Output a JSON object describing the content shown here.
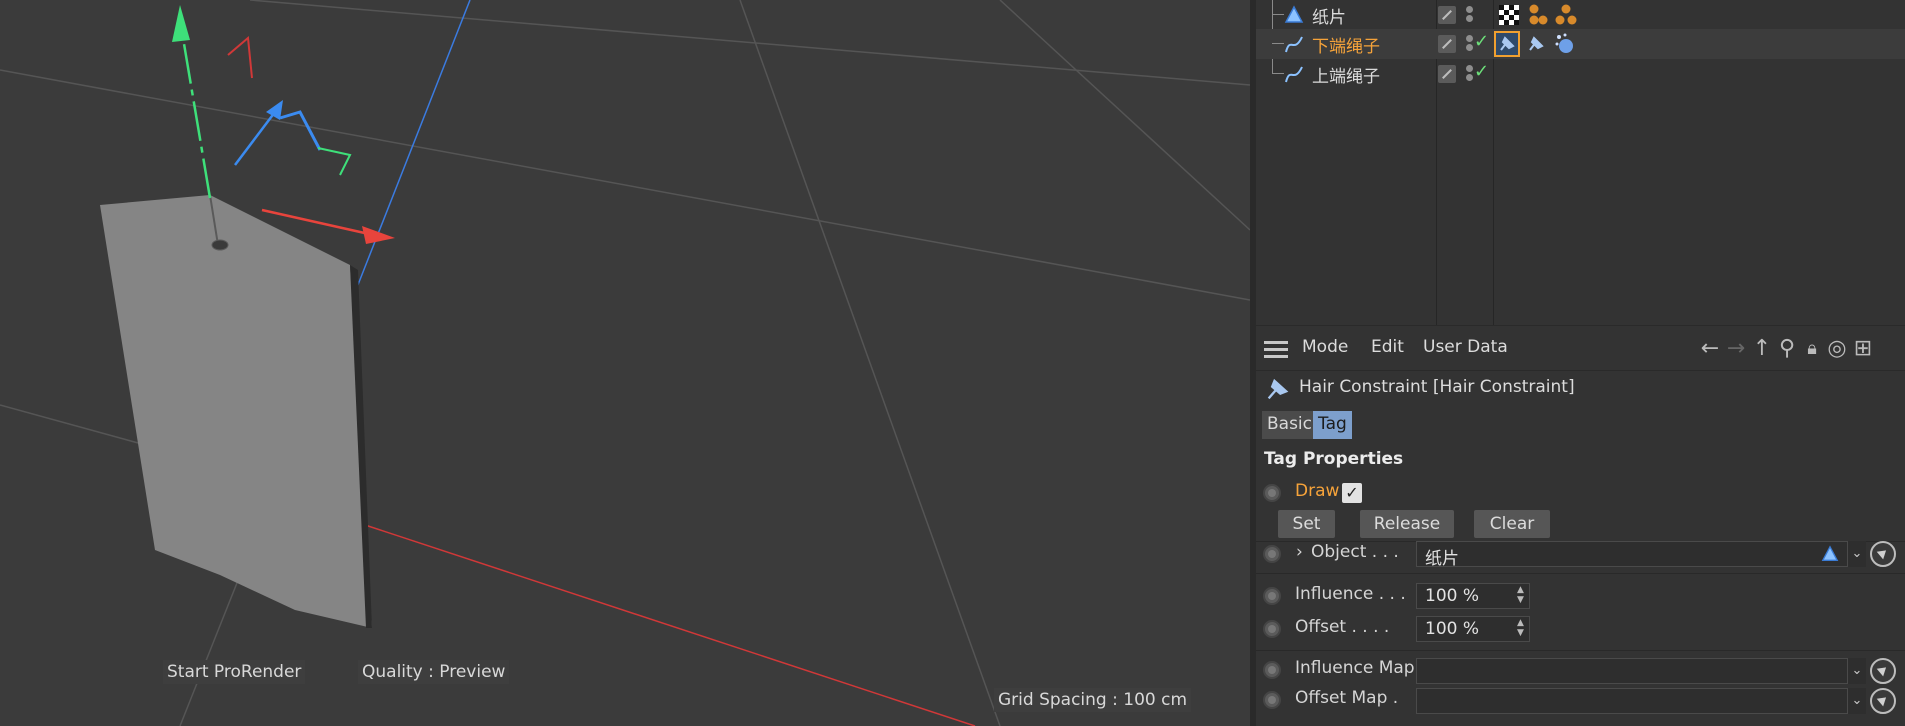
{
  "viewport": {
    "start_prorender": "Start ProRender",
    "quality": "Quality : Preview",
    "grid_spacing": "Grid Spacing : 100 cm"
  },
  "object_manager": {
    "rows": [
      {
        "name": "纸片",
        "icon": "polygon-object-icon",
        "active": false
      },
      {
        "name": "下端绳子",
        "icon": "spline-icon",
        "active": true
      },
      {
        "name": "上端绳子",
        "icon": "spline-icon",
        "active": false
      }
    ]
  },
  "attributes": {
    "menu": {
      "mode": "Mode",
      "edit": "Edit",
      "user_data": "User Data"
    },
    "title": "Hair Constraint [Hair Constraint]",
    "tabs": {
      "basic": "Basic",
      "tag": "Tag"
    },
    "section": "Tag Properties",
    "draw_label": "Draw",
    "buttons": {
      "set": "Set",
      "release": "Release",
      "clear": "Clear"
    },
    "object_label": "Object . . .",
    "object_value": "纸片",
    "influence_label": "Influence . . .",
    "influence_value": "100 %",
    "offset_label": "Offset . . . .",
    "offset_value": "100 %",
    "influence_map_label": "Influence Map",
    "offset_map_label": "Offset Map ."
  },
  "colors": {
    "accent_orange": "#f6a33a",
    "tab_active": "#7d9fcc",
    "check_green": "#6ce07a",
    "axis_x": "#e8443c",
    "axis_y": "#3ee07a",
    "axis_z": "#3b8bf0"
  }
}
